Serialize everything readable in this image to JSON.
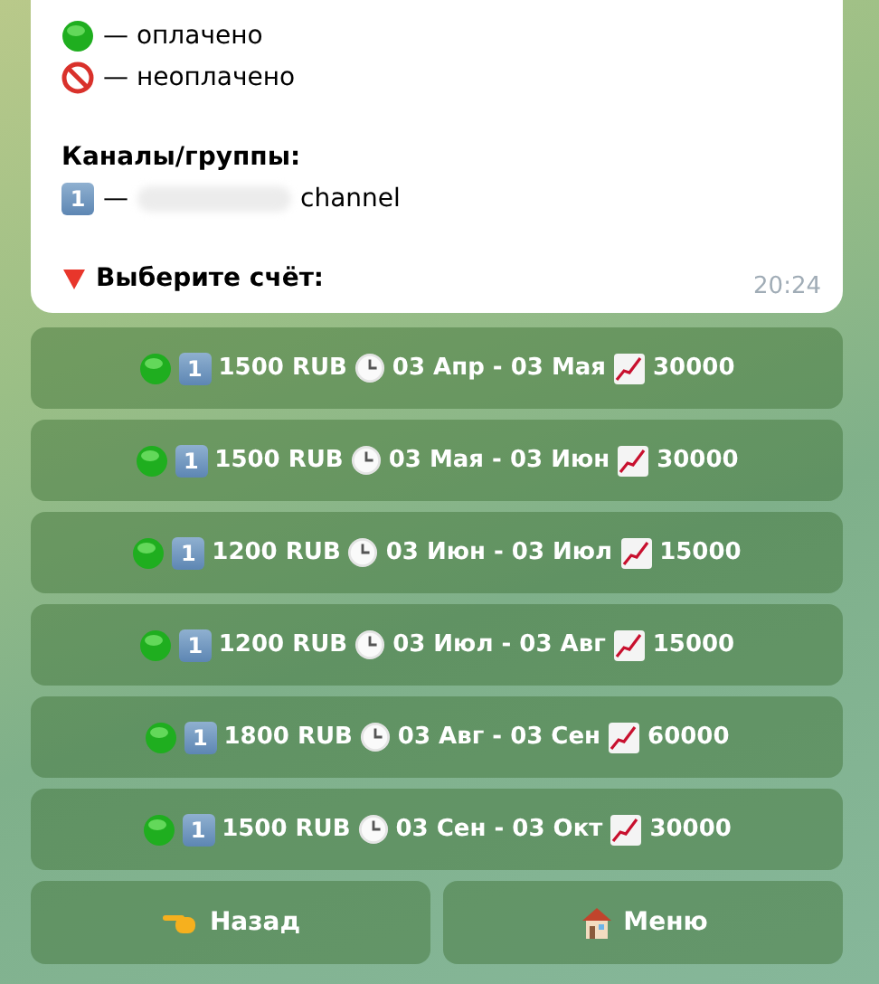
{
  "message": {
    "legend": [
      {
        "paid": true,
        "label": "— оплачено"
      },
      {
        "paid": false,
        "label": "— неоплачено"
      }
    ],
    "channels_heading": "Каналы/группы:",
    "channels": [
      {
        "keycap": "1",
        "dash": "—",
        "name": "channel"
      }
    ],
    "prompt": "Выберите счёт:",
    "time": "20:24"
  },
  "invoices": [
    {
      "paid": true,
      "keycap": "1",
      "amount": "1500 RUB",
      "period": "03 Апр - 03 Мая",
      "subscribers": "30000"
    },
    {
      "paid": true,
      "keycap": "1",
      "amount": "1500 RUB",
      "period": "03 Мая - 03 Июн",
      "subscribers": "30000"
    },
    {
      "paid": true,
      "keycap": "1",
      "amount": "1200 RUB",
      "period": "03 Июн - 03 Июл",
      "subscribers": "15000"
    },
    {
      "paid": true,
      "keycap": "1",
      "amount": "1200 RUB",
      "period": "03 Июл - 03 Авг",
      "subscribers": "15000"
    },
    {
      "paid": true,
      "keycap": "1",
      "amount": "1800 RUB",
      "period": "03 Авг - 03 Сен",
      "subscribers": "60000"
    },
    {
      "paid": true,
      "keycap": "1",
      "amount": "1500 RUB",
      "period": "03 Сен - 03 Окт",
      "subscribers": "30000"
    }
  ],
  "nav_buttons": [
    {
      "kind": "back",
      "label": "Назад"
    },
    {
      "kind": "menu",
      "label": "Меню"
    }
  ]
}
